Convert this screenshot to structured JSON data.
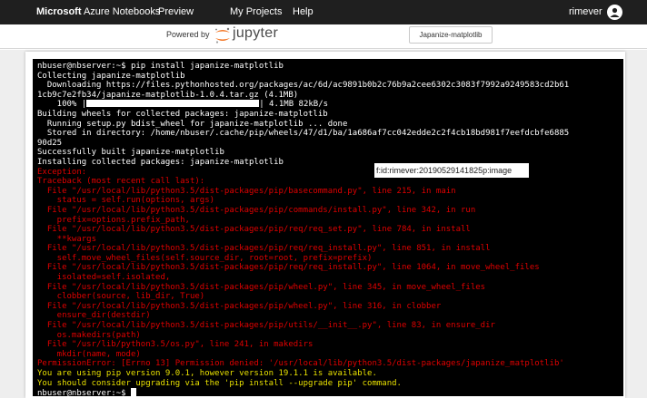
{
  "topbar": {
    "brand_bold": "Microsoft",
    "brand_rest": " Azure Notebooks",
    "preview": "Preview",
    "my_projects": "My Projects",
    "help": "Help",
    "username": "rimever"
  },
  "subbar": {
    "powered_by": "Powered by",
    "jupyter": "jupyter",
    "notebook_name": "Japanize-matplotlib"
  },
  "overlay_text": "f:id:rimever:20190529141825p:image",
  "terminal": {
    "lines": [
      {
        "c": "w",
        "t": "nbuser@nbserver:~$ pip install japanize-matplotlib"
      },
      {
        "c": "w",
        "t": "Collecting japanize-matplotlib"
      },
      {
        "c": "w",
        "t": "  Downloading https://files.pythonhosted.org/packages/ac/6d/ac9891b0b2c76b9a2cee6302c3083f7992a9249583cd2b61"
      },
      {
        "c": "w",
        "t": "1cb9c7e2fb34/japanize-matplotlib-1.0.4.tar.gz (4.1MB)"
      },
      {
        "c": "w",
        "t": "    100% |",
        "bar": true,
        "after": "| 4.1MB 82kB/s"
      },
      {
        "c": "w",
        "t": "Building wheels for collected packages: japanize-matplotlib"
      },
      {
        "c": "w",
        "t": "  Running setup.py bdist_wheel for japanize-matplotlib ... done"
      },
      {
        "c": "w",
        "t": "  Stored in directory: /home/nbuser/.cache/pip/wheels/47/d1/ba/1a686af7cc042edde2c2f4cb18bd981f7eefdcbfe6885"
      },
      {
        "c": "w",
        "t": "90d25"
      },
      {
        "c": "w",
        "t": "Successfully built japanize-matplotlib"
      },
      {
        "c": "w",
        "t": "Installing collected packages: japanize-matplotlib"
      },
      {
        "c": "r",
        "t": "Exception:"
      },
      {
        "c": "r",
        "t": "Traceback (most recent call last):"
      },
      {
        "c": "r",
        "t": "  File \"/usr/local/lib/python3.5/dist-packages/pip/basecommand.py\", line 215, in main"
      },
      {
        "c": "r",
        "t": "    status = self.run(options, args)"
      },
      {
        "c": "r",
        "t": "  File \"/usr/local/lib/python3.5/dist-packages/pip/commands/install.py\", line 342, in run"
      },
      {
        "c": "r",
        "t": "    prefix=options.prefix_path,"
      },
      {
        "c": "r",
        "t": "  File \"/usr/local/lib/python3.5/dist-packages/pip/req/req_set.py\", line 784, in install"
      },
      {
        "c": "r",
        "t": "    **kwargs"
      },
      {
        "c": "r",
        "t": "  File \"/usr/local/lib/python3.5/dist-packages/pip/req/req_install.py\", line 851, in install"
      },
      {
        "c": "r",
        "t": "    self.move_wheel_files(self.source_dir, root=root, prefix=prefix)"
      },
      {
        "c": "r",
        "t": "  File \"/usr/local/lib/python3.5/dist-packages/pip/req/req_install.py\", line 1064, in move_wheel_files"
      },
      {
        "c": "r",
        "t": "    isolated=self.isolated,"
      },
      {
        "c": "r",
        "t": "  File \"/usr/local/lib/python3.5/dist-packages/pip/wheel.py\", line 345, in move_wheel_files"
      },
      {
        "c": "r",
        "t": "    clobber(source, lib_dir, True)"
      },
      {
        "c": "r",
        "t": "  File \"/usr/local/lib/python3.5/dist-packages/pip/wheel.py\", line 316, in clobber"
      },
      {
        "c": "r",
        "t": "    ensure_dir(destdir)"
      },
      {
        "c": "r",
        "t": "  File \"/usr/local/lib/python3.5/dist-packages/pip/utils/__init__.py\", line 83, in ensure_dir"
      },
      {
        "c": "r",
        "t": "    os.makedirs(path)"
      },
      {
        "c": "r",
        "t": "  File \"/usr/lib/python3.5/os.py\", line 241, in makedirs"
      },
      {
        "c": "r",
        "t": "    mkdir(name, mode)"
      },
      {
        "c": "r",
        "t": "PermissionError: [Errno 13] Permission denied: '/usr/local/lib/python3.5/dist-packages/japanize_matplotlib'"
      },
      {
        "c": "y",
        "t": "You are using pip version 9.0.1, however version 19.1.1 is available."
      },
      {
        "c": "y",
        "t": "You should consider upgrading via the 'pip install --upgrade pip' command."
      },
      {
        "c": "w",
        "t": "nbuser@nbserver:~$ ",
        "cursor": true
      }
    ]
  }
}
